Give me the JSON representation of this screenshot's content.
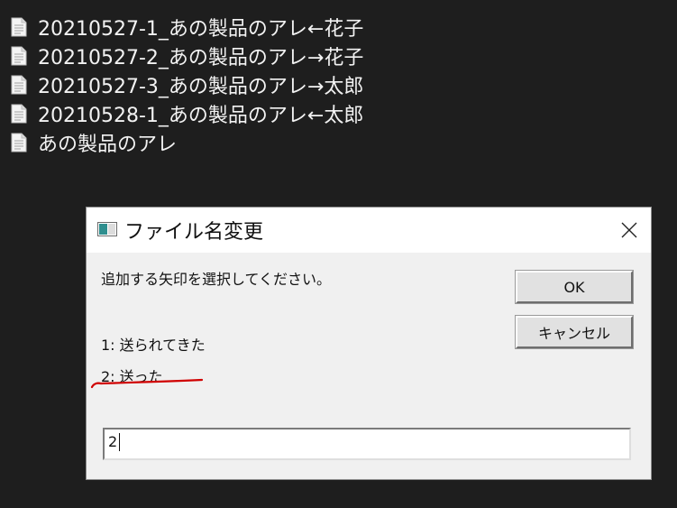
{
  "file_list": {
    "items": [
      {
        "name": "20210527-1_あの製品のアレ←花子",
        "icon": "document-icon"
      },
      {
        "name": "20210527-2_あの製品のアレ→花子",
        "icon": "document-icon"
      },
      {
        "name": "20210527-3_あの製品のアレ→太郎",
        "icon": "document-icon"
      },
      {
        "name": "20210528-1_あの製品のアレ←太郎",
        "icon": "document-icon"
      },
      {
        "name": "あの製品のアレ",
        "icon": "document-icon"
      }
    ]
  },
  "dialog": {
    "title": "ファイル名変更",
    "title_icon": "app-window-icon",
    "close_icon": "close-icon",
    "prompt": "追加する矢印を選択してください。",
    "options": [
      "1: 送られてきた",
      "2: 送った"
    ],
    "ok_label": "OK",
    "cancel_label": "キャンセル",
    "input_value": "2"
  },
  "colors": {
    "background": "#1e1e1e",
    "file_text": "#f2f2f2",
    "dialog_bg": "#f0f0f0",
    "annotation": "#d00000"
  }
}
